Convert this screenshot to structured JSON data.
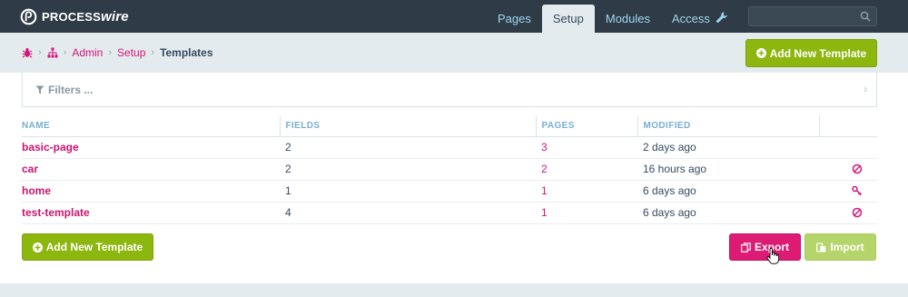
{
  "brand": {
    "name_part1": "PROCESS",
    "name_part2": "wire"
  },
  "nav": {
    "items": [
      {
        "label": "Pages",
        "active": false
      },
      {
        "label": "Setup",
        "active": true
      },
      {
        "label": "Modules",
        "active": false
      },
      {
        "label": "Access",
        "active": false
      }
    ],
    "search_placeholder": ""
  },
  "breadcrumb": {
    "items": [
      "Admin",
      "Setup"
    ],
    "current": "Templates"
  },
  "actions": {
    "add_new_template": "Add New Template",
    "export": "Export",
    "import": "Import"
  },
  "filters": {
    "label": "Filters ..."
  },
  "table": {
    "headers": [
      "NAME",
      "FIELDS",
      "PAGES",
      "MODIFIED",
      ""
    ],
    "rows": [
      {
        "name": "basic-page",
        "fields": "2",
        "pages": "3",
        "modified": "2 days ago",
        "icon": ""
      },
      {
        "name": "car",
        "fields": "2",
        "pages": "2",
        "modified": "16 hours ago",
        "icon": "ban-icon"
      },
      {
        "name": "home",
        "fields": "1",
        "pages": "1",
        "modified": "6 days ago",
        "icon": "key-icon"
      },
      {
        "name": "test-template",
        "fields": "4",
        "pages": "1",
        "modified": "6 days ago",
        "icon": "ban-icon"
      }
    ]
  },
  "colors": {
    "topbar": "#2f3c47",
    "accent_pink": "#dd1a74",
    "accent_green": "#8db60f",
    "nav_link": "#9fd4ef"
  }
}
